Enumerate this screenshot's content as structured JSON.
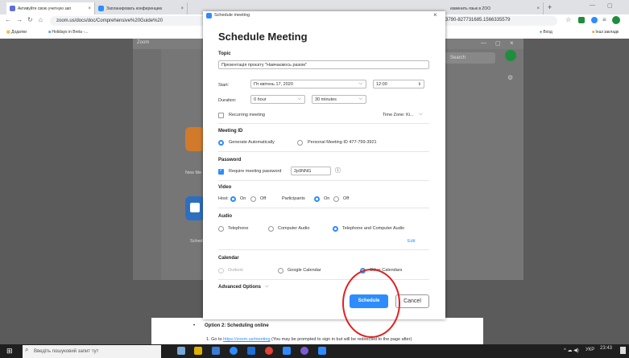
{
  "browser": {
    "tabs": [
      {
        "label": "Активуйте свою учетную зап",
        "fav": "#5b6fd6"
      },
      {
        "label": "Запланировать конференцию",
        "fav": "#2d8cff"
      },
      {
        "label": "",
        "fav": "#2d8cff"
      },
      {
        "label": "изменить язык в ZOO",
        "fav": "#2d8cff"
      }
    ],
    "url": "zoom.us/docs/doc/Comprehensive%20Guide%20",
    "url_tail": "3790-827731685.1566335579",
    "bookmarks": {
      "apps": "Додатки",
      "b1": "Holidays in Brela -...",
      "login": "Вход",
      "other": "Інші закладк"
    }
  },
  "zoom_window": {
    "title": "Zoom",
    "search_placeholder": "Search",
    "new_meeting": "New Me",
    "schedule": "Sched",
    "join_suffix": "n"
  },
  "modal": {
    "window_title": "Schedule meeting",
    "heading": "Schedule Meeting",
    "topic": {
      "label": "Topic",
      "value": "Презентація проєкту \"Навчаємось разом\""
    },
    "start": {
      "label": "Start:",
      "date": "Пт квітень 17, 2020",
      "time": "12:00"
    },
    "duration": {
      "label": "Duration:",
      "hours": "0 hour",
      "minutes": "30 minutes"
    },
    "recurring": {
      "label": "Recurring meeting",
      "timezone": "Time Zone: Ki..."
    },
    "meeting_id": {
      "label": "Meeting ID",
      "auto": "Generate Automatically",
      "personal": "Personal Meeting ID 477-799-3921"
    },
    "password": {
      "label": "Password",
      "require": "Require meeting password",
      "value": "2p9NNG"
    },
    "video": {
      "label": "Video",
      "host": "Host:",
      "on": "On",
      "off": "Off",
      "participants": "Participants"
    },
    "audio": {
      "label": "Audio",
      "telephone": "Telephone",
      "computer": "Computer Audio",
      "both": "Telephone and Computer Audio",
      "edit": "Edit"
    },
    "calendar": {
      "label": "Calendar",
      "outlook": "Outlook",
      "google": "Google Calendar",
      "other": "Other Calendars"
    },
    "advanced": "Advanced Options",
    "schedule_btn": "Schedule",
    "cancel_btn": "Cancel"
  },
  "doc": {
    "heading": "Option 2: Scheduling online",
    "item_num": "1.",
    "item_text_prefix": "Go to ",
    "item_link": "https://zoom.us/meeting",
    "item_text_suffix": " (You may be prompted to sign in but will be redirected to the page after)"
  },
  "taskbar": {
    "search": "Введіть пошуковий запит тут",
    "lang": "УКР",
    "time": "23:43"
  },
  "colors": {
    "accent": "#2d8cff",
    "annotation": "#e02020"
  }
}
